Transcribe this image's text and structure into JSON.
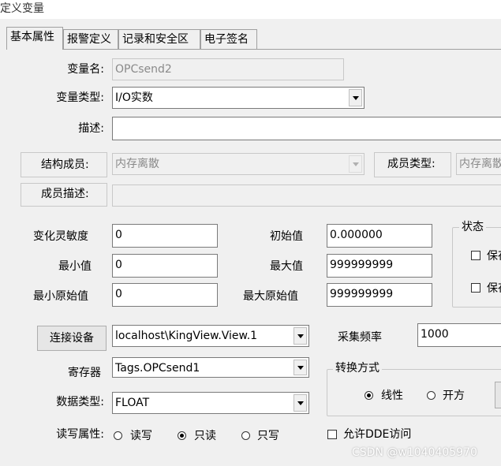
{
  "window": {
    "title": "定义变量"
  },
  "tabs": [
    {
      "label": "基本属性",
      "active": true
    },
    {
      "label": "报警定义",
      "active": false
    },
    {
      "label": "记录和安全区",
      "active": false
    },
    {
      "label": "电子签名",
      "active": false
    }
  ],
  "basic": {
    "var_name_label": "变量名:",
    "var_name_value": "OPCsend2",
    "var_type_label": "变量类型:",
    "var_type_value": "I/O实数",
    "desc_label": "描述:",
    "desc_value": "",
    "struct_member_label": "结构成员:",
    "struct_member_value": "内存离散",
    "member_type_label": "成员类型:",
    "member_type_value": "内存离散",
    "member_desc_label": "成员描述:",
    "member_desc_value": ""
  },
  "params": {
    "sensitivity_label": "变化灵敏度",
    "sensitivity_value": "0",
    "min_label": "最小值",
    "min_value": "0",
    "min_raw_label": "最小原始值",
    "min_raw_value": "0",
    "initial_label": "初始值",
    "initial_value": "0.000000",
    "max_label": "最大值",
    "max_value": "999999999",
    "max_raw_label": "最大原始值",
    "max_raw_value": "999999999"
  },
  "status_group": {
    "title": "状态",
    "check1": "保存",
    "check2": "保存"
  },
  "device": {
    "connect_button": "连接设备",
    "device_value": "localhost\\KingView.View.1",
    "freq_label": "采集频率",
    "freq_value": "1000",
    "register_label": "寄存器",
    "register_value": "Tags.OPCsend1",
    "datatype_label": "数据类型:",
    "datatype_value": "FLOAT",
    "rw_label": "读写属性:",
    "rw_options": [
      "读写",
      "只读",
      "只写"
    ],
    "rw_selected": "只读"
  },
  "convert_group": {
    "title": "转换方式",
    "options": [
      "线性",
      "开方"
    ],
    "selected": "线性"
  },
  "dde": {
    "label": "允许DDE访问"
  },
  "watermark": "CSDN @w1040405970"
}
